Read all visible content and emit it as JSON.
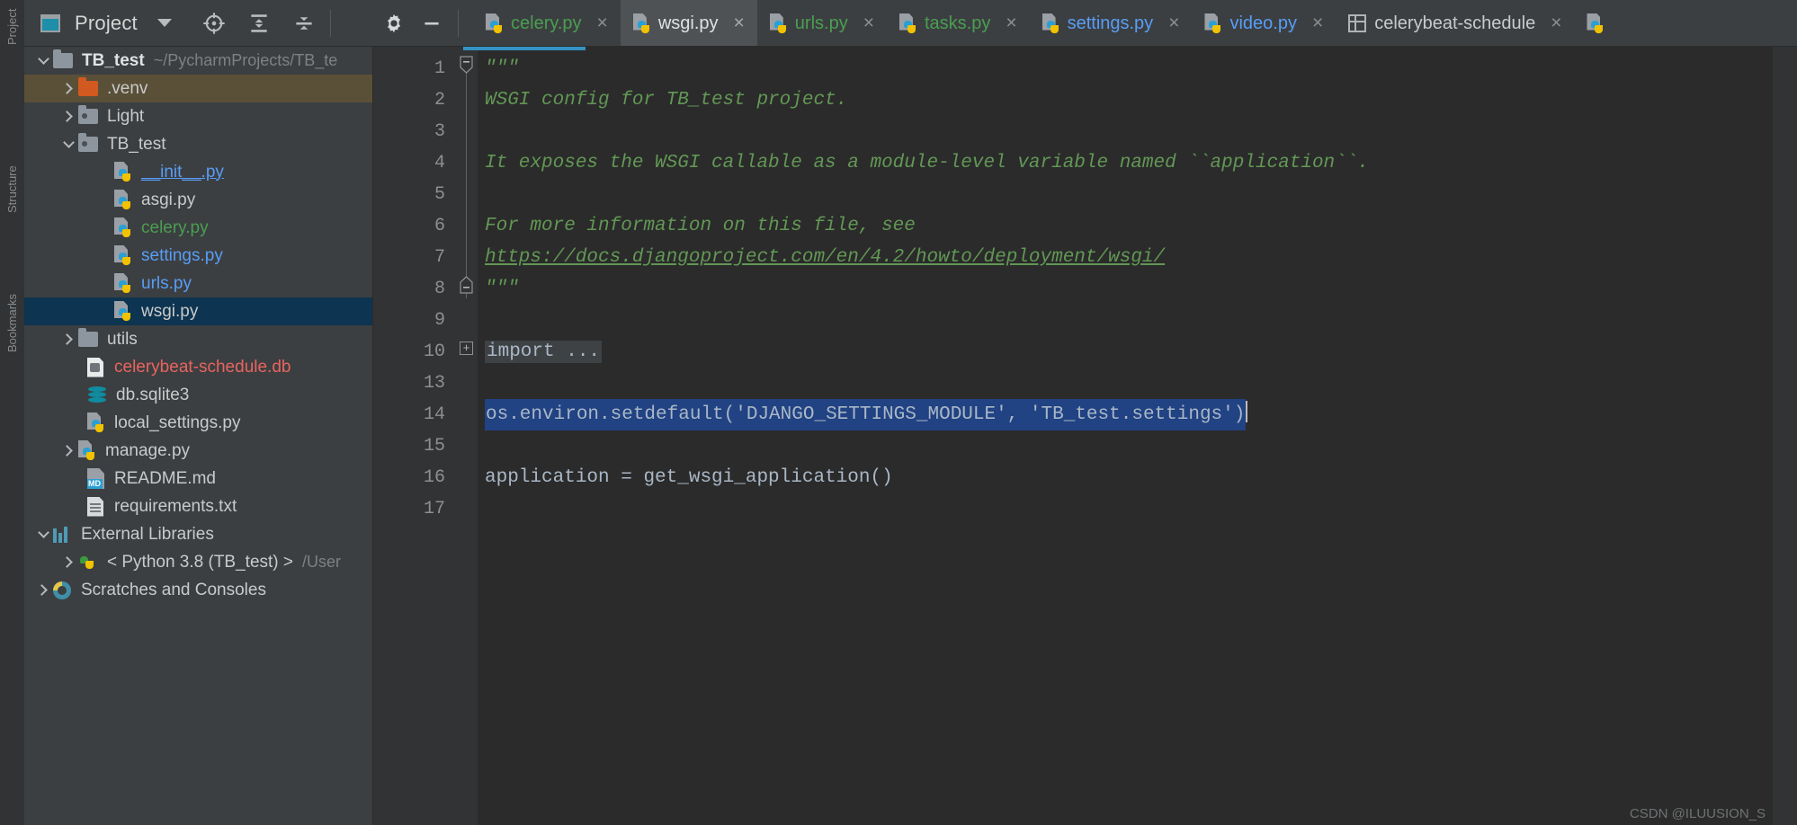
{
  "left_stripe": {
    "label": "Project"
  },
  "left_stripe2": {
    "labels": [
      "Structure",
      "Bookmarks"
    ]
  },
  "project_toolbar": {
    "title": "Project",
    "icons": {
      "window_icon": "project-window-icon",
      "dropdown": "chevron-down-icon",
      "locate": "select-opened-file-icon",
      "expand_all": "expand-all-icon",
      "collapse_all": "collapse-all-icon"
    }
  },
  "tabbar_tools": {
    "settings": "gear-icon",
    "hide": "minimize-icon"
  },
  "tabs": [
    {
      "name": "celery.py",
      "icon": "python-file-icon",
      "color": "#4a9e52",
      "active": false,
      "close": "×"
    },
    {
      "name": "wsgi.py",
      "icon": "python-file-icon",
      "color": "#dfe1e2",
      "active": true,
      "close": "×"
    },
    {
      "name": "urls.py",
      "icon": "python-file-icon",
      "color": "#4a9e52",
      "active": false,
      "close": "×"
    },
    {
      "name": "tasks.py",
      "icon": "python-file-icon",
      "color": "#4a9e52",
      "active": false,
      "close": "×"
    },
    {
      "name": "settings.py",
      "icon": "python-file-icon",
      "color": "#589df6",
      "active": false,
      "close": "×"
    },
    {
      "name": "video.py",
      "icon": "python-file-icon",
      "color": "#589df6",
      "active": false,
      "close": "×"
    },
    {
      "name": "celerybeat-schedule",
      "icon": "table-file-icon",
      "color": "#c8cacb",
      "active": false,
      "close": "×"
    }
  ],
  "tree": [
    {
      "label": "TB_test",
      "suffix": "~/PycharmProjects/TB_te",
      "icon": "folder-icon",
      "indent": 0,
      "arrow": "down",
      "style": "root",
      "state": "normal"
    },
    {
      "label": ".venv",
      "icon": "folder-orange-icon",
      "indent": 1,
      "arrow": "right",
      "style": "white",
      "state": "highlighted"
    },
    {
      "label": "Light",
      "icon": "folder-module-icon",
      "indent": 1,
      "arrow": "right",
      "style": "white",
      "state": "normal"
    },
    {
      "label": "TB_test",
      "icon": "folder-module-icon",
      "indent": 1,
      "arrow": "down",
      "style": "white",
      "state": "normal"
    },
    {
      "label": "__init__.py",
      "icon": "python-file-icon",
      "indent": 2,
      "arrow": "none",
      "style": "blue-underline",
      "state": "normal"
    },
    {
      "label": "asgi.py",
      "icon": "python-file-icon",
      "indent": 2,
      "arrow": "none",
      "style": "white",
      "state": "normal"
    },
    {
      "label": "celery.py",
      "icon": "python-file-icon",
      "indent": 2,
      "arrow": "none",
      "style": "green",
      "state": "normal"
    },
    {
      "label": "settings.py",
      "icon": "python-file-icon",
      "indent": 2,
      "arrow": "none",
      "style": "blue",
      "state": "normal"
    },
    {
      "label": "urls.py",
      "icon": "python-file-icon",
      "indent": 2,
      "arrow": "none",
      "style": "blue",
      "state": "normal"
    },
    {
      "label": "wsgi.py",
      "icon": "python-file-icon",
      "indent": 2,
      "arrow": "none",
      "style": "white",
      "state": "selected"
    },
    {
      "label": "utils",
      "icon": "folder-icon",
      "indent": 1,
      "arrow": "right",
      "style": "white",
      "state": "normal"
    },
    {
      "label": "celerybeat-schedule.db",
      "icon": "db-file-icon",
      "indent": 1,
      "arrow": "none",
      "style": "red",
      "state": "normal"
    },
    {
      "label": "db.sqlite3",
      "icon": "database-icon",
      "indent": 1,
      "arrow": "none",
      "style": "white",
      "state": "normal"
    },
    {
      "label": "local_settings.py",
      "icon": "python-file-icon",
      "indent": 1,
      "arrow": "none",
      "style": "white",
      "state": "normal"
    },
    {
      "label": "manage.py",
      "icon": "python-file-icon",
      "indent": 1,
      "arrow": "right",
      "style": "white",
      "state": "normal"
    },
    {
      "label": "README.md",
      "icon": "markdown-file-icon",
      "indent": 1,
      "arrow": "none",
      "style": "white",
      "state": "normal"
    },
    {
      "label": "requirements.txt",
      "icon": "text-file-icon",
      "indent": 1,
      "arrow": "none",
      "style": "white",
      "state": "normal"
    },
    {
      "label": "External Libraries",
      "icon": "libraries-icon",
      "indent": 0,
      "arrow": "down",
      "style": "white",
      "state": "normal"
    },
    {
      "label": "< Python 3.8 (TB_test) >",
      "suffix": "/User",
      "icon": "python-interpreter-icon",
      "indent": 1,
      "arrow": "right",
      "style": "white",
      "state": "normal"
    },
    {
      "label": "Scratches and Consoles",
      "icon": "scratches-icon",
      "indent": 0,
      "arrow": "right",
      "style": "white",
      "state": "normal"
    }
  ],
  "editor": {
    "file": "wsgi.py",
    "line_numbers": [
      "1",
      "2",
      "3",
      "4",
      "5",
      "6",
      "7",
      "8",
      "9",
      "10",
      "13",
      "14",
      "15",
      "16",
      "17"
    ],
    "lines": [
      {
        "n": "1",
        "text": "\"\"\"",
        "type": "doc"
      },
      {
        "n": "2",
        "text": "WSGI config for TB_test project.",
        "type": "doc"
      },
      {
        "n": "3",
        "text": "",
        "type": "doc"
      },
      {
        "n": "4",
        "text": "It exposes the WSGI callable as a module-level variable named ``application``.",
        "type": "doc"
      },
      {
        "n": "5",
        "text": "",
        "type": "doc"
      },
      {
        "n": "6",
        "text": "For more information on this file, see",
        "type": "doc"
      },
      {
        "n": "7",
        "text": "https://docs.djangoproject.com/en/4.2/howto/deployment/wsgi/",
        "type": "link"
      },
      {
        "n": "8",
        "text": "\"\"\"",
        "type": "doc"
      },
      {
        "n": "9",
        "text": "",
        "type": "blank"
      },
      {
        "n": "10",
        "text": "import ...",
        "type": "fold"
      },
      {
        "n": "13",
        "text": "",
        "type": "blank"
      },
      {
        "n": "14",
        "text": "os.environ.setdefault('DJANGO_SETTINGS_MODULE', 'TB_test.settings')",
        "type": "selected"
      },
      {
        "n": "15",
        "text": "",
        "type": "blank"
      },
      {
        "n": "16",
        "text": "application = get_wsgi_application()",
        "type": "code"
      },
      {
        "n": "17",
        "text": "",
        "type": "blank"
      }
    ],
    "selected_line_parts": {
      "prefix": "os.environ.setdefault(",
      "arg1": "'DJANGO_SETTINGS_MODULE'",
      "comma": ", ",
      "arg2": "'TB_test.settings'",
      "suffix": ")"
    },
    "code_line_16": {
      "name": "application",
      "eq": " = ",
      "call": "get_wsgi_application()"
    },
    "colors": {
      "docstring": "#629755",
      "string": "#6a8759",
      "selection": "#214283",
      "background": "#2b2b2b",
      "gutter": "#313335",
      "default_text": "#a9b7c6"
    }
  },
  "watermark": "CSDN @ILUUSION_S"
}
